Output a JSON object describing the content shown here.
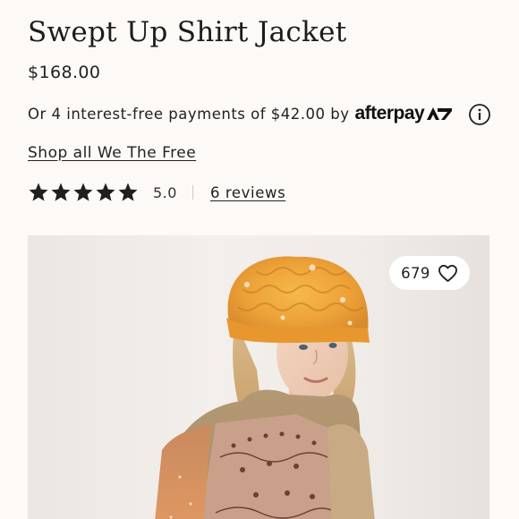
{
  "product": {
    "title": "Swept Up Shirt Jacket",
    "price": "$168.00"
  },
  "afterpay": {
    "text": "Or 4 interest-free payments of $42.00 by",
    "logo_text": "afterpay",
    "logo_icon": "afterpay-arrows-icon",
    "info_icon": "info-circle-icon"
  },
  "brand_link": {
    "label": "Shop all We The Free"
  },
  "rating": {
    "stars": 5,
    "max_stars": 5,
    "value": "5.0",
    "reviews_label": "6 reviews"
  },
  "favorite": {
    "count": "679",
    "icon": "heart-outline-icon"
  },
  "image": {
    "alt_subject": "model wearing orange chunky knit beanie and bandana-print shirt jacket"
  },
  "colors": {
    "background": "#fcf9f6",
    "text": "#1f1f1f",
    "star": "#1f1f1f"
  }
}
